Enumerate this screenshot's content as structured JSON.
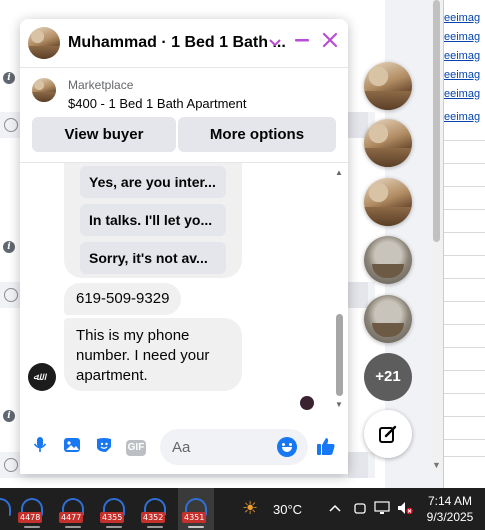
{
  "background": {
    "link_fragment": "eeimag"
  },
  "chat": {
    "header_title": "Muhammad · 1 Bed 1 Bath ...",
    "listing_source": "Marketplace",
    "listing_title": "$400 - 1 Bed 1 Bath Apartment",
    "buttons": {
      "view_buyer": "View buyer",
      "more_options": "More options"
    },
    "suggestions": [
      "Yes, are you inter...",
      "In talks. I'll let yo...",
      "Sorry, it's not av..."
    ],
    "messages": [
      "619-509-9329",
      "This is my phone number. I need your apartment."
    ],
    "composer_placeholder": "Aa",
    "gif_label": "GIF",
    "accent_color": "#b84cd6",
    "brand_color": "#1877f2"
  },
  "chat_heads": {
    "more_count": "+21"
  },
  "taskbar": {
    "app_badges": [
      "4478",
      "4477",
      "4355",
      "4352",
      "4351"
    ],
    "temperature": "30°C",
    "time": "7:14 AM",
    "date": "9/3/2025"
  }
}
